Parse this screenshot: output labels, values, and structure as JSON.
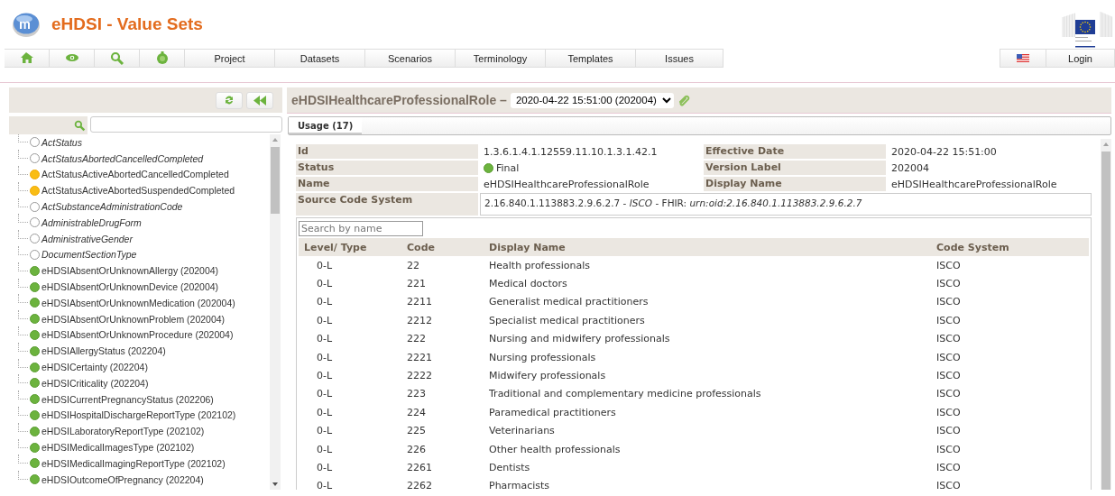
{
  "header": {
    "title": "eHDSI - Value Sets"
  },
  "nav": {
    "menu": [
      {
        "label": "Project"
      },
      {
        "label": "Datasets"
      },
      {
        "label": "Scenarios"
      },
      {
        "label": "Terminology"
      },
      {
        "label": "Templates"
      },
      {
        "label": "Issues"
      }
    ],
    "login": "Login"
  },
  "sidebar": {
    "items": [
      {
        "label": "ActStatus",
        "kind": "none"
      },
      {
        "label": "ActStatusAbortedCancelledCompleted",
        "kind": "none"
      },
      {
        "label": "ActStatusActiveAbortedCancelledCompleted",
        "kind": "draft"
      },
      {
        "label": "ActStatusActiveAbortedSuspendedCompleted",
        "kind": "draft"
      },
      {
        "label": "ActSubstanceAdministrationCode",
        "kind": "none"
      },
      {
        "label": "AdministrableDrugForm",
        "kind": "none"
      },
      {
        "label": "AdministrativeGender",
        "kind": "none"
      },
      {
        "label": "DocumentSectionType",
        "kind": "none"
      },
      {
        "label": "eHDSIAbsentOrUnknownAllergy (202004)",
        "kind": "final"
      },
      {
        "label": "eHDSIAbsentOrUnknownDevice (202004)",
        "kind": "final"
      },
      {
        "label": "eHDSIAbsentOrUnknownMedication (202004)",
        "kind": "final"
      },
      {
        "label": "eHDSIAbsentOrUnknownProblem (202004)",
        "kind": "final"
      },
      {
        "label": "eHDSIAbsentOrUnknownProcedure (202004)",
        "kind": "final"
      },
      {
        "label": "eHDSIAllergyStatus (202204)",
        "kind": "final"
      },
      {
        "label": "eHDSICertainty (202204)",
        "kind": "final"
      },
      {
        "label": "eHDSICriticality (202204)",
        "kind": "final"
      },
      {
        "label": "eHDSICurrentPregnancyStatus (202206)",
        "kind": "final"
      },
      {
        "label": "eHDSIHospitalDischargeReportType (202102)",
        "kind": "final"
      },
      {
        "label": "eHDSILaboratoryReportType (202102)",
        "kind": "final"
      },
      {
        "label": "eHDSIMedicalImagesType (202102)",
        "kind": "final"
      },
      {
        "label": "eHDSIMedicalImagingReportType (202102)",
        "kind": "final"
      },
      {
        "label": "eHDSIOutcomeOfPregnancy (202204)",
        "kind": "final"
      }
    ]
  },
  "detail": {
    "title": "eHDSIHealthcareProfessionalRole –",
    "version": "2020-04-22 15:51:00 (202004)",
    "tabs": [
      {
        "label": "Usage (17)",
        "selected": true
      }
    ],
    "properties": [
      {
        "label": "Id",
        "value": "1.3.6.1.4.1.12559.11.10.1.3.1.42.1"
      },
      {
        "label": "Effective Date",
        "value": "2020-04-22 15:51:00"
      },
      {
        "label": "Status",
        "value": "Final",
        "kind": "final"
      },
      {
        "label": "Version Label",
        "value": "202004"
      },
      {
        "label": "Name",
        "value": "eHDSIHealthcareProfessionalRole"
      },
      {
        "label": "Display Name",
        "value": "eHDSIHealthcareProfessionalRole"
      }
    ],
    "source_code_system": {
      "label": "Source Code System",
      "value": "2.16.840.1.113883.2.9.6.2.7 - *ISCO* - FHIR: *urn:oid:2.16.840.1.113883.2.9.6.2.7*"
    },
    "concepts": {
      "search": {
        "placeholder": "Search by name"
      },
      "columns": [
        "Level/ Type",
        "Code",
        "Display Name",
        "Code System"
      ],
      "rows": [
        [
          "0-L",
          "22",
          "Health professionals",
          "ISCO"
        ],
        [
          "0-L",
          "221",
          "Medical doctors",
          "ISCO"
        ],
        [
          "0-L",
          "2211",
          "Generalist medical practitioners",
          "ISCO"
        ],
        [
          "0-L",
          "2212",
          "Specialist medical practitioners",
          "ISCO"
        ],
        [
          "0-L",
          "222",
          "Nursing and midwifery professionals",
          "ISCO"
        ],
        [
          "0-L",
          "2221",
          "Nursing professionals",
          "ISCO"
        ],
        [
          "0-L",
          "2222",
          "Midwifery professionals",
          "ISCO"
        ],
        [
          "0-L",
          "223",
          "Traditional and complementary medicine professionals",
          "ISCO"
        ],
        [
          "0-L",
          "224",
          "Paramedical practitioners",
          "ISCO"
        ],
        [
          "0-L",
          "225",
          "Veterinarians",
          "ISCO"
        ],
        [
          "0-L",
          "226",
          "Other health professionals",
          "ISCO"
        ],
        [
          "0-L",
          "2261",
          "Dentists",
          "ISCO"
        ],
        [
          "0-L",
          "2262",
          "Pharmacists",
          "ISCO"
        ]
      ]
    }
  }
}
